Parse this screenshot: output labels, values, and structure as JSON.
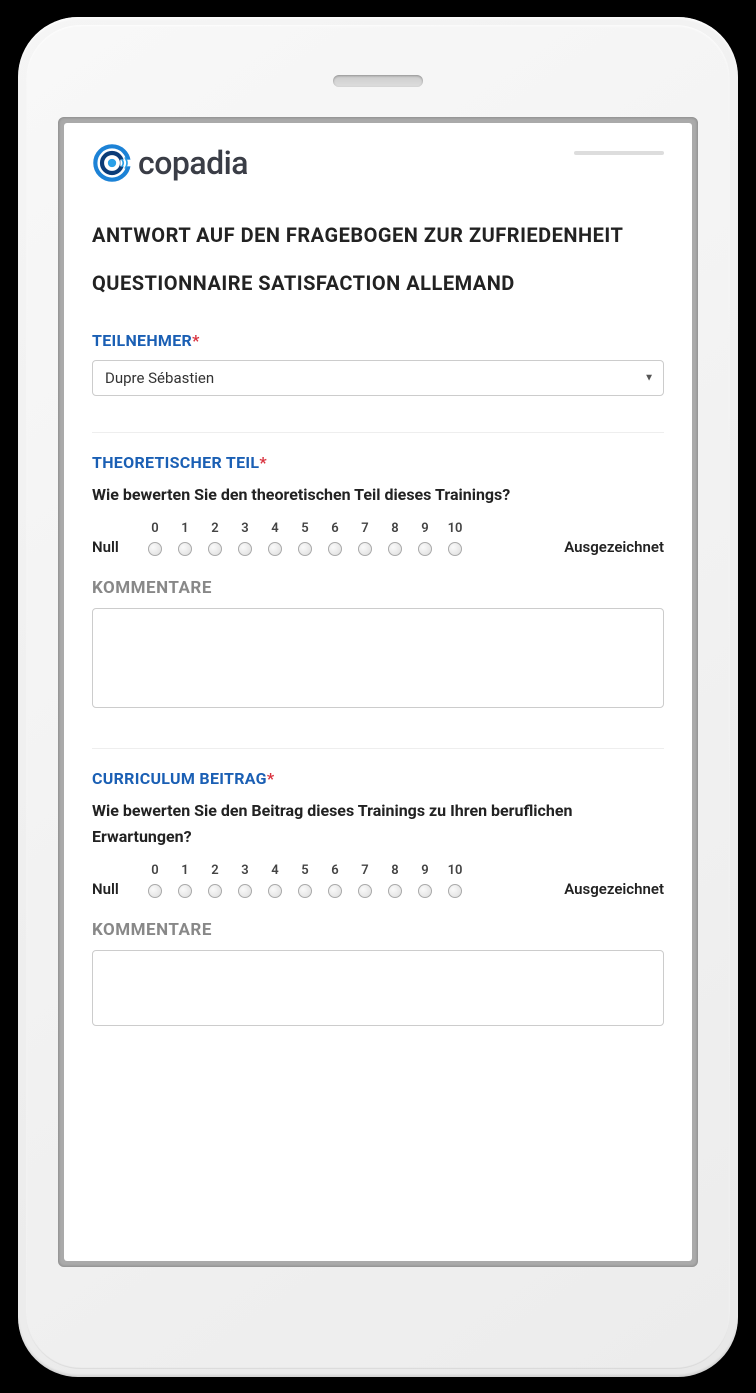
{
  "brand": {
    "name": "copadia"
  },
  "page": {
    "title": "ANTWORT AUF DEN FRAGEBOGEN ZUR ZUFRIEDENHEIT QUESTIONNAIRE SATISFACTION ALLEMAND"
  },
  "participant": {
    "label": "TEILNEHMER",
    "selected": "Dupre Sébastien"
  },
  "rating_scale": {
    "low_label": "Null",
    "high_label": "Ausgezeichnet",
    "values": [
      "0",
      "1",
      "2",
      "3",
      "4",
      "5",
      "6",
      "7",
      "8",
      "9",
      "10"
    ]
  },
  "sections": [
    {
      "label": "THEORETISCHER TEIL",
      "question": "Wie bewerten Sie den theoretischen Teil dieses Trainings?",
      "comment_label": "KOMMENTARE",
      "comment_value": ""
    },
    {
      "label": "CURRICULUM BEITRAG",
      "question": "Wie bewerten Sie den Beitrag dieses Trainings zu Ihren beruflichen Erwartungen?",
      "comment_label": "KOMMENTARE",
      "comment_value": ""
    }
  ]
}
